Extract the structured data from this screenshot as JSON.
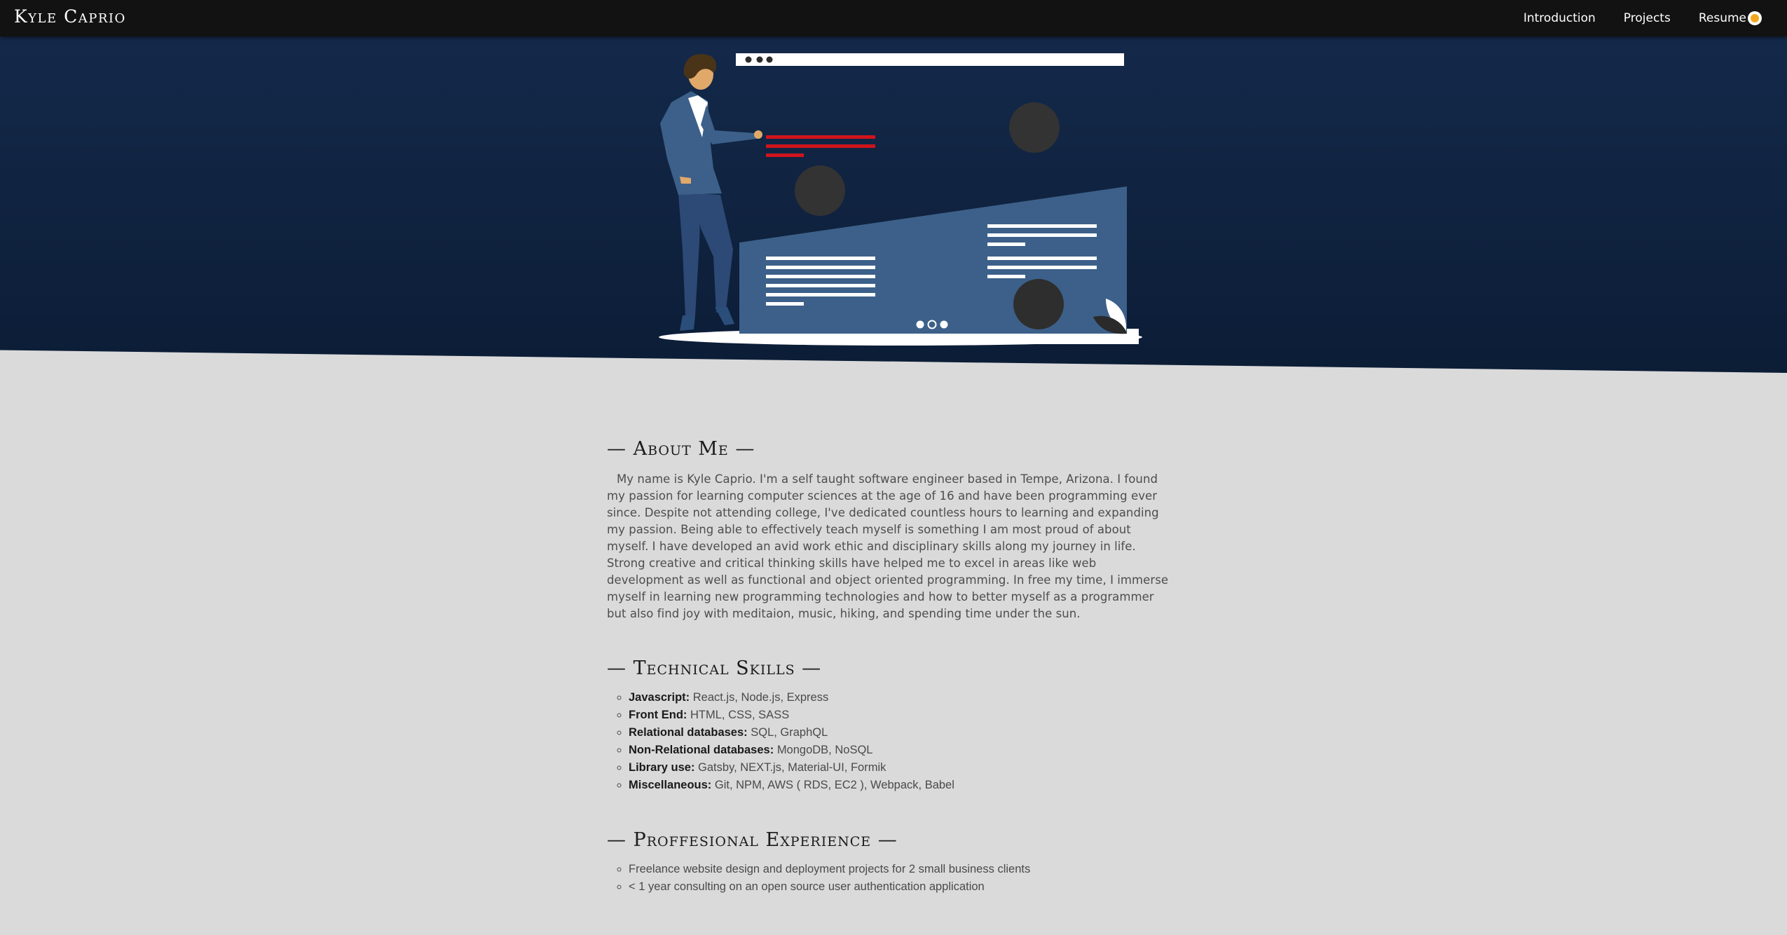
{
  "nav": {
    "brand": "Kyle Caprio",
    "links": [
      "Introduction",
      "Projects",
      "Resume"
    ],
    "theme_toggle_icon": "sun-toggle-icon"
  },
  "colors": {
    "nav_bg": "#121212",
    "hero_top": "#14294a",
    "hero_bottom": "#0b1c35",
    "page_bg": "#dadada",
    "accent_red": "#d0141c",
    "figure_blue": "#3c6089",
    "toggle_sun": "#f0a81e"
  },
  "about": {
    "title": "— About Me —",
    "text": "My name is Kyle Caprio. I'm a self taught software engineer based in Tempe, Arizona. I found my passion for learning computer sciences at the age of 16 and have been programming ever since. Despite not attending college, I've dedicated countless hours to learning and expanding my passion. Being able to effectively teach myself is something I am most proud of about myself. I have developed an avid work ethic and disciplinary skills along my journey in life. Strong creative and critical thinking skills have helped me to excel in areas like web development as well as functional and object oriented programming. In free my time, I immerse myself in learning new programming technologies and how to better myself as a programmer but also find joy with meditaion, music, hiking, and spending time under the sun."
  },
  "skills": {
    "title": "— Technical Skills —",
    "items": [
      {
        "name": "Javascript:",
        "value": "React.js, Node.js, Express"
      },
      {
        "name": "Front End:",
        "value": "HTML, CSS, SASS"
      },
      {
        "name": "Relational databases:",
        "value": "SQL, GraphQL"
      },
      {
        "name": "Non-Relational databases:",
        "value": "MongoDB, NoSQL"
      },
      {
        "name": "Library use:",
        "value": "Gatsby, NEXT.js, Material-UI, Formik"
      },
      {
        "name": "Miscellaneous:",
        "value": "Git, NPM, AWS ( RDS, EC2 ), Webpack, Babel"
      }
    ]
  },
  "experience": {
    "title": "— Proffesional Experience —",
    "items": [
      "Freelance website design and deployment projects for 2 small business clients",
      "< 1 year consulting on an open source user authentication application"
    ]
  }
}
